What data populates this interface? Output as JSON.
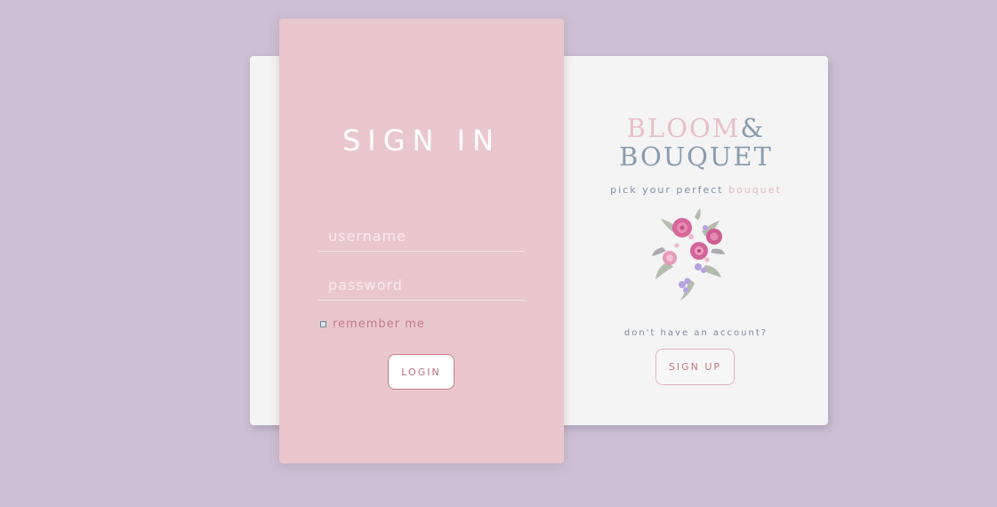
{
  "signin": {
    "title": "SIGN IN",
    "username_placeholder": "username",
    "password_placeholder": "password",
    "remember_label": "remember me",
    "login_label": "LOGIN"
  },
  "brand": {
    "word1": "BLOOM",
    "amp": "&",
    "word2": "BOUQUET",
    "tagline_prefix": "pick your perfect ",
    "tagline_accent": "bouquet"
  },
  "signup": {
    "prompt": "don't have an account?",
    "button_label": "SIGN UP"
  },
  "colors": {
    "background": "#cdc0d4",
    "signin_card": "#eac7cd",
    "info_card": "#f4f4f4",
    "accent_pink": "#e9c0c8",
    "accent_slate": "#8a9bb0",
    "button_text": "#b86f7c"
  },
  "icons": {
    "bouquet": "flower-bouquet-illustration"
  }
}
